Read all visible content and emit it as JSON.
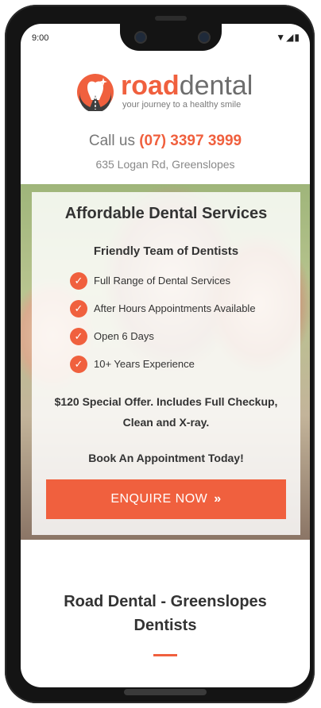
{
  "status_bar": {
    "time": "9:00",
    "icons": "▼◢▮"
  },
  "logo": {
    "brand_part1": "road",
    "brand_part2": "dental",
    "tagline": "your journey to a healthy smile"
  },
  "contact": {
    "call_prefix": "Call us",
    "phone": "(07) 3397 3999",
    "address": "635 Logan Rd, Greenslopes"
  },
  "hero": {
    "title": "Affordable Dental Services",
    "subtitle": "Friendly Team of Dentists",
    "features": [
      "Full Range of Dental Services",
      "After Hours Appointments Available",
      "Open 6 Days",
      "10+ Years Experience"
    ],
    "offer": "$120 Special Offer. Includes Full Checkup, Clean and X-ray.",
    "book": "Book An Appointment Today!",
    "cta_label": "ENQUIRE NOW",
    "cta_icon": "»"
  },
  "section": {
    "title": "Road Dental - Greenslopes Dentists"
  },
  "colors": {
    "accent": "#f0603e",
    "text_dark": "#333333",
    "text_muted": "#777777"
  }
}
